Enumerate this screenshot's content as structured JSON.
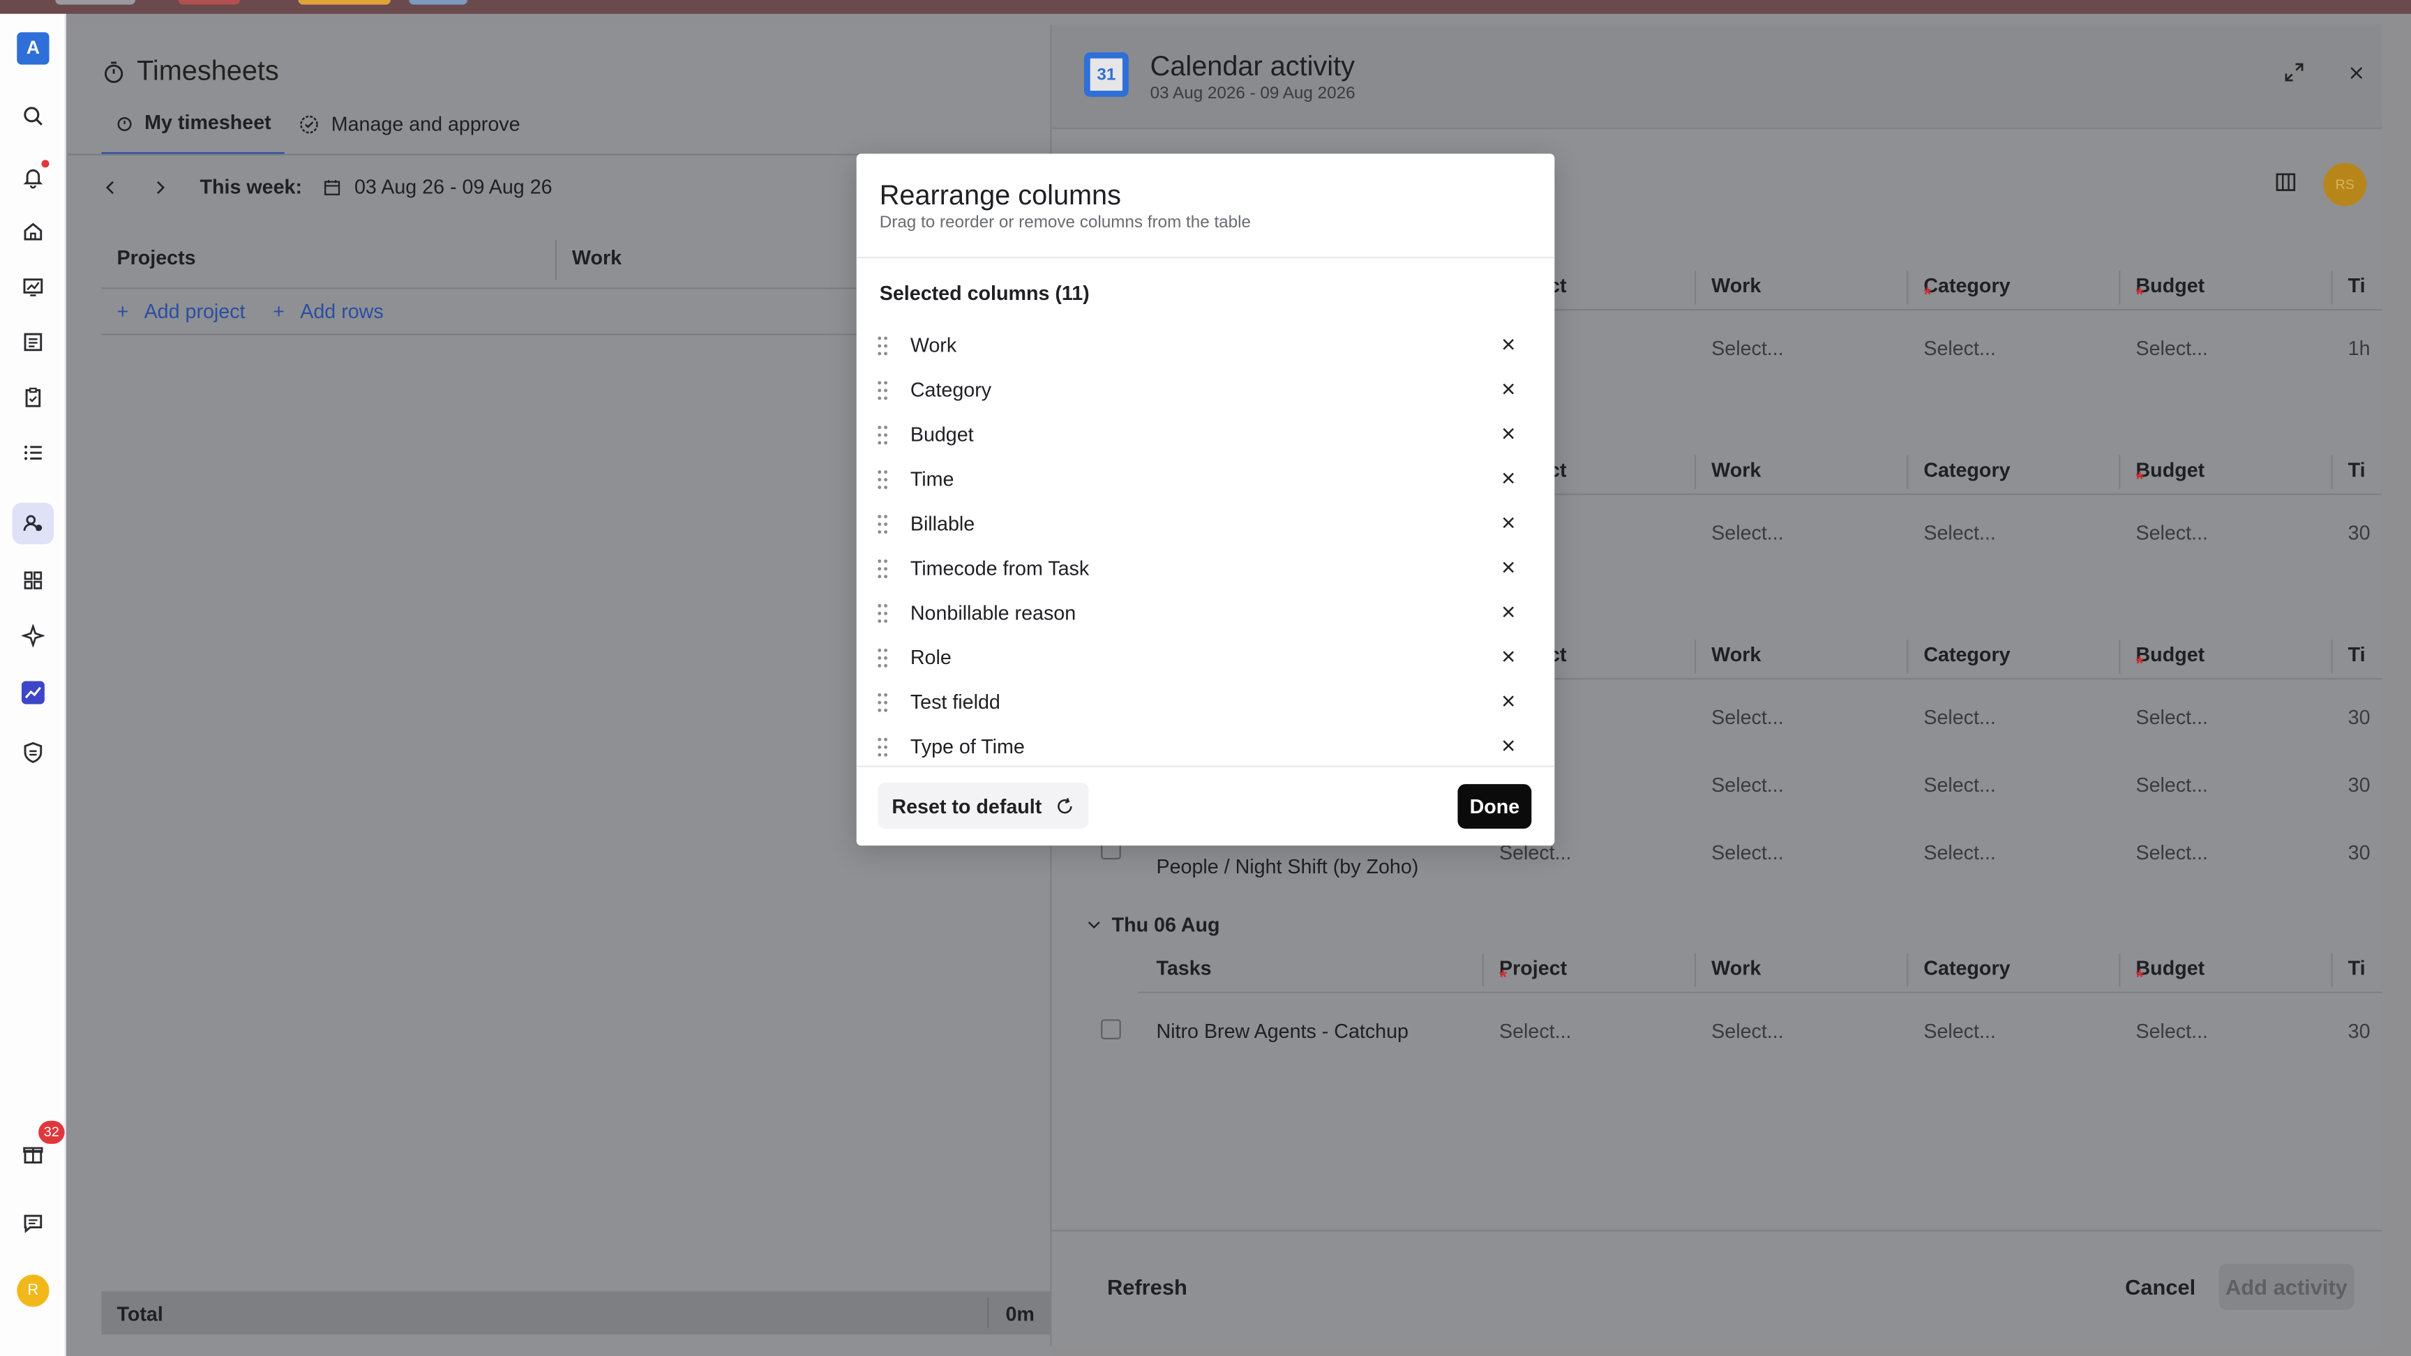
{
  "rail": {
    "logo": "A",
    "user_initial": "R",
    "gift_badge": "32",
    "icons": [
      "search-icon",
      "bell-icon",
      "home-icon",
      "dashboard-icon",
      "book-icon",
      "clipboard-icon",
      "list-icon",
      "people-icon",
      "apps-icon",
      "sparkle-icon",
      "chart-icon",
      "shield-icon",
      "gift-icon",
      "chat-icon"
    ]
  },
  "timesheet": {
    "title": "Timesheets",
    "tabs": [
      {
        "label": "My timesheet"
      },
      {
        "label": "Manage and approve"
      }
    ],
    "week_label": "This week:",
    "week_range": "03 Aug 26 - 09 Aug 26",
    "columns": [
      "Projects",
      "Work"
    ],
    "add_project": "Add project",
    "add_rows": "Add rows",
    "total_label": "Total",
    "total_value": "0m"
  },
  "drawer": {
    "title": "Calendar activity",
    "subtitle": "03 Aug 2026 - 09 Aug 2026",
    "calendar_day": "31",
    "avatar": "RS",
    "header_partial": [
      "ect",
      "Work",
      "Category",
      "Budget",
      "Ti"
    ],
    "rows": [
      {
        "a": "...",
        "work": "Select...",
        "category": "Select...",
        "budget": "Select...",
        "time": "1h"
      },
      {
        "a": "...",
        "work": "Select...",
        "category": "Select...",
        "budget": "Select...",
        "time": "30"
      },
      {
        "a": "...",
        "work": "Select...",
        "category": "Select...",
        "budget": "Select...",
        "time": "30"
      },
      {
        "a": "...",
        "work": "Select...",
        "category": "Select...",
        "budget": "Select...",
        "time": "30"
      },
      {
        "task": "People / Night Shift (by Zoho)",
        "a": "Select...",
        "work": "Select...",
        "category": "Select...",
        "budget": "Select...",
        "time": "30"
      }
    ],
    "day_group": "Thu 06 Aug",
    "day_header": [
      "Tasks",
      "Project",
      "Work",
      "Category",
      "Budget",
      "Ti"
    ],
    "day_row": {
      "task": "Nitro Brew Agents - Catchup",
      "project": "Select...",
      "work": "Select...",
      "category": "Select...",
      "budget": "Select...",
      "time": "30"
    },
    "refresh": "Refresh",
    "cancel": "Cancel",
    "add_activity": "Add activity"
  },
  "modal": {
    "title": "Rearrange columns",
    "subtitle": "Drag to reorder or remove columns from the table",
    "selected_label": "Selected columns (11)",
    "items": [
      "Work",
      "Category",
      "Budget",
      "Time",
      "Billable",
      "Timecode from Task",
      "Nonbillable reason",
      "Role",
      "Test fieldd",
      "Type of Time"
    ],
    "reset": "Reset to default",
    "done": "Done"
  },
  "colors": {
    "accent": "#2a4ea3",
    "rail_active": "#dfe1f7",
    "danger": "#e0373c"
  }
}
